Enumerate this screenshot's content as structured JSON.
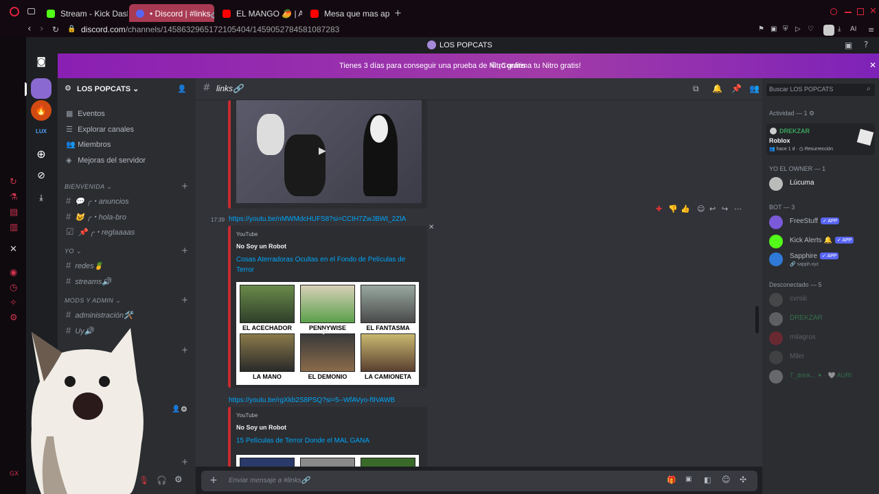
{
  "browser": {
    "tabs": [
      {
        "label": "Stream - Kick Dashboard",
        "color": "#53fc18"
      },
      {
        "label": "• Discord | #links🔗 | LOS",
        "color": "#5865f2"
      },
      {
        "label": "EL MANGO 🥭 | Animació",
        "color": "#ff0000"
      },
      {
        "label": "Mesa que mas aplauda - Y",
        "color": "#ff0000"
      }
    ],
    "url_host": "discord.com",
    "url_path": "/channels/1458632965172105404/1459052784581087283",
    "ai_label": "AI"
  },
  "discord": {
    "window_title": "LOS POPCATS",
    "banner": {
      "message": "Tienes 3 días para conseguir una prueba de Nitro gratis",
      "cta": "¡Confirma tu Nitro gratis!"
    },
    "server_list": [
      {
        "icon": "discord-icon",
        "label": ""
      },
      {
        "icon": "popcat-server",
        "label": ""
      },
      {
        "icon": "fire-server",
        "label": ""
      },
      {
        "icon": "lux-server",
        "label": "LUX"
      },
      {
        "icon": "add-icon",
        "label": ""
      },
      {
        "icon": "compass-icon",
        "label": ""
      },
      {
        "icon": "download-icon",
        "label": ""
      }
    ],
    "server_name": "LOS POPCATS",
    "nav_items": [
      {
        "icon": "calendar-icon",
        "label": "Eventos"
      },
      {
        "icon": "list-icon",
        "label": "Explorar canales"
      },
      {
        "icon": "members-icon",
        "label": "Miembros"
      },
      {
        "icon": "boost-icon",
        "label": "Mejoras del servidor"
      }
    ],
    "categories": [
      {
        "label": "BIENVENIDA",
        "channels": [
          "💬 ╭・anuncios",
          "😺 ╭・hola-bro",
          "📌 ╭・reglaaaas"
        ]
      },
      {
        "label": "YO",
        "channels": [
          "redes🍍",
          "streams🔊"
        ]
      },
      {
        "label": "MODS Y ADMIN",
        "channels": [
          "administración🛠️",
          "Uy🔊"
        ]
      }
    ],
    "channel_name": "links🔗",
    "search_placeholder": "Buscar LOS POPCATS",
    "messages": {
      "timestamp": "17:39",
      "link1": "https://youtu.be/nMWMdcHUFS8?si=CCtH7ZwJBWt_2ZlA",
      "embed1": {
        "provider": "YouTube",
        "author": "No Soy un Robot",
        "title": "Cosas Aterradoras Ocultas en el Fondo de Películas de Terror",
        "captions": [
          "EL ACECHADOR",
          "PENNYWISE",
          "EL FANTASMA",
          "LA MANO",
          "EL DEMONIO",
          "LA CAMIONETA"
        ]
      },
      "link2": "https://youtu.be/rgXkb2S8PSQ?si=5--WfAVyo-f9VAWB",
      "embed2": {
        "provider": "YouTube",
        "author": "No Soy un Robot",
        "title": "15 Películas de Terror Donde el MAL GANA"
      }
    },
    "input_placeholder": "Enviar mensaje a #links🔗",
    "members": {
      "activity_header": "Actividad — 1",
      "activity": {
        "name": "DREKZAR",
        "game": "Roblox",
        "meta": "hace 1 d",
        "extra": "Resurrección"
      },
      "owner_header": "YO EL OWNER — 1",
      "owner": "Lúcuma",
      "bot_header": "BOT — 3",
      "bots": [
        {
          "name": "FreeStuff",
          "badge": "✓ APP",
          "sub": ""
        },
        {
          "name": "Kick Alerts 🔔",
          "badge": "✓ APP",
          "sub": ""
        },
        {
          "name": "Sapphire",
          "badge": "✓ APP",
          "sub": "🔗 sapph.xyz"
        }
      ],
      "offline_header": "Desconectado — 5",
      "offline": [
        "cvrsiii",
        "DREKZAR",
        "milagros",
        "Milei",
        "T_drink... ✦ · 🤍 AURI"
      ]
    }
  }
}
